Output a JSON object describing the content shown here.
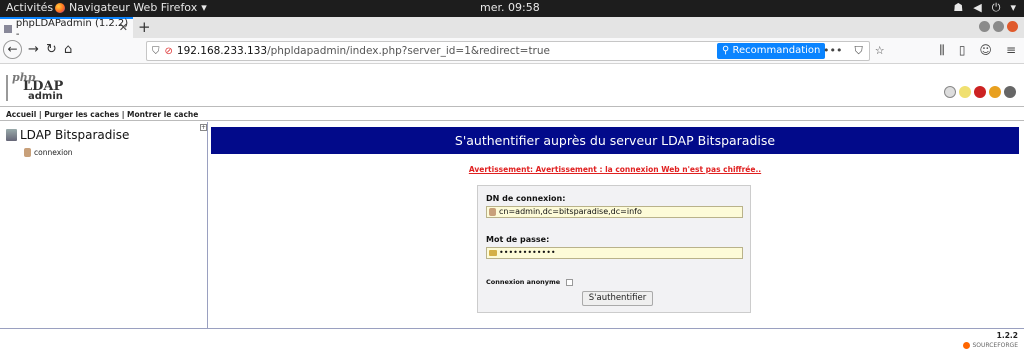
{
  "system": {
    "activities": "Activités",
    "app_name": "Navigateur Web Firefox",
    "clock": "mer. 09:58"
  },
  "browser": {
    "tab_title": "phpLDAPadmin (1.2.2) -",
    "url_host": "192.168.233.133",
    "url_path": "/phpldapadmin/index.php?server_id=1&redirect=true",
    "recommendation_label": "Recommandation"
  },
  "header": {
    "logo_php": "php",
    "logo_ldap": "LDAP",
    "logo_admin": "admin",
    "links": "Accueil | Purger les caches | Montrer le cache"
  },
  "sidebar": {
    "server_name": "LDAP Bitsparadise",
    "login_link": "connexion"
  },
  "main": {
    "title": "S'authentifier auprès du serveur LDAP Bitsparadise",
    "warning": "Avertissement: Avertissement : la connexion Web n'est pas chiffrée..",
    "dn_label": "DN de connexion:",
    "dn_value": "cn=admin,dc=bitsparadise,dc=info",
    "password_label": "Mot de passe:",
    "password_value": "••••••••••••",
    "anonymous_label": "Connexion anonyme",
    "submit_label": "S'authentifier"
  },
  "footer": {
    "version": "1.2.2",
    "sourceforge": "SOURCEFORGE"
  }
}
